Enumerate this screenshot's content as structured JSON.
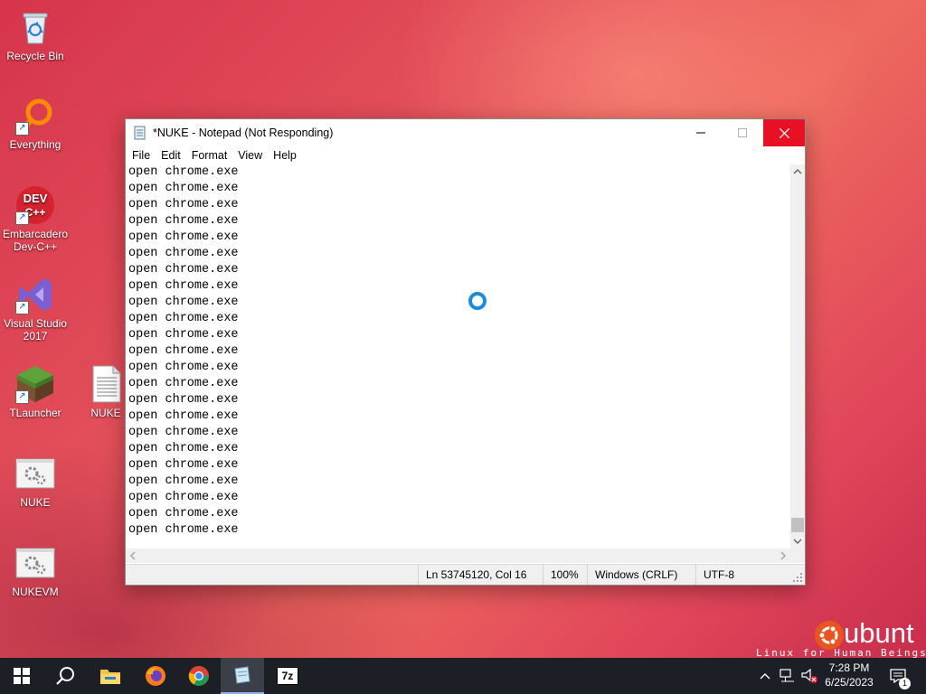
{
  "desktop": {
    "icons": [
      {
        "label": "Recycle Bin"
      },
      {
        "label": "Everything"
      },
      {
        "label": "Embarcadero Dev-C++"
      },
      {
        "label": "Visual Studio 2017"
      },
      {
        "label": "TLauncher"
      },
      {
        "label": "NUKE"
      },
      {
        "label": "NUKE"
      },
      {
        "label": "NUKEVM"
      }
    ],
    "dev_icon_text_top": "DEV",
    "dev_icon_text_bottom": "C++",
    "watermark_brand": "ubunt",
    "watermark_tagline": "Linux for Human Beings"
  },
  "window": {
    "title": "*NUKE - Notepad (Not Responding)",
    "menu": [
      "File",
      "Edit",
      "Format",
      "View",
      "Help"
    ],
    "lines": [
      "open chrome.exe",
      "open chrome.exe",
      "open chrome.exe",
      "open chrome.exe",
      "open chrome.exe",
      "open chrome.exe",
      "open chrome.exe",
      "open chrome.exe",
      "open chrome.exe",
      "open chrome.exe",
      "open chrome.exe",
      "open chrome.exe",
      "open chrome.exe",
      "open chrome.exe",
      "open chrome.exe",
      "open chrome.exe",
      "open chrome.exe",
      "open chrome.exe",
      "open chrome.exe",
      "open chrome.exe",
      "open chrome.exe",
      "open chrome.exe",
      "open chrome.exe"
    ],
    "status": {
      "position": "Ln 53745120, Col 16",
      "zoom": "100%",
      "line_ending": "Windows (CRLF)",
      "encoding": "UTF-8"
    },
    "busy_cursor": "loading-spinner"
  },
  "taskbar": {
    "pinned": [
      "start",
      "search",
      "file-explorer",
      "firefox",
      "chrome",
      "notepad",
      "7-zip"
    ],
    "seven_zip_label": "7z",
    "time": "7:28 PM",
    "date": "6/25/2023",
    "notification_count": "1"
  },
  "colors": {
    "close_button": "#e81123",
    "taskbar": "#1c1f26",
    "spinner": "#1a8cd8"
  }
}
